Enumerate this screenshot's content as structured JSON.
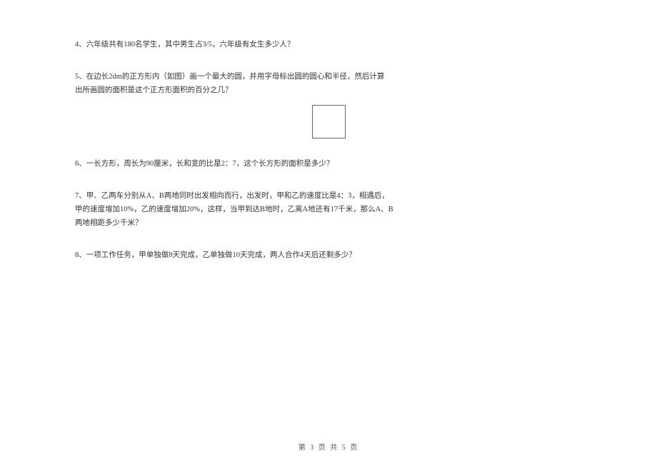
{
  "questions": {
    "q4": "4、六年级共有180名学生，其中男生占3/5，六年级有女生多少人？",
    "q5_line1": "5、在边长2dm的正方形内（如图）画一个最大的圆，并用字母标出圆的圆心和半径，然后计算",
    "q5_line2": "出所画圆的面积是这个正方形面积的百分之几？",
    "q6": "6、一长方形，周长为90厘米，长和宽的比是2：7，这个长方形的面积是多少？",
    "q7_line1": "7、甲、乙两车分别从A、B两地同时出发相向而行，出发时，甲和乙的速度比是4：3，相遇后，",
    "q7_line2": "甲的速度增加10%，乙的速度增加20%，这样，当甲到达B地时，乙离A地还有17千米，那么A、B",
    "q7_line3": "两地相距多少千米？",
    "q8": "8、一项工作任务，甲单独做8天完成，乙单独做10天完成，两人合作4天后还剩多少？"
  },
  "footer": "第 3 页 共 5 页"
}
